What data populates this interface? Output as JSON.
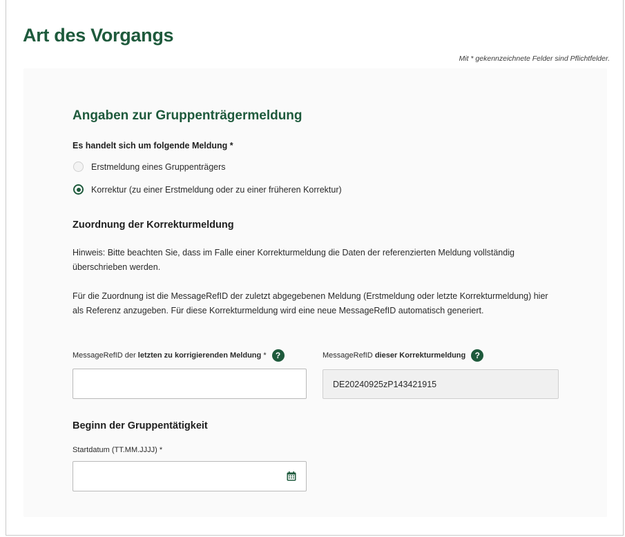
{
  "page": {
    "title": "Art des Vorgangs",
    "required_note": "Mit * gekennzeichnete Felder sind Pflichtfelder."
  },
  "section": {
    "title": "Angaben zur Gruppenträgermeldung",
    "question": "Es handelt sich um folgende Meldung *",
    "options": [
      {
        "label": "Erstmeldung eines Gruppenträgers",
        "selected": false
      },
      {
        "label": "Korrektur (zu einer Erstmeldung oder zu einer früheren Korrektur)",
        "selected": true
      }
    ]
  },
  "correction": {
    "heading": "Zuordnung der Korrekturmeldung",
    "hint": "Hinweis: Bitte beachten Sie, dass im Falle einer Korrekturmeldung die Daten der referenzierten Meldung vollständig überschrieben werden.",
    "info": "Für die Zuordnung ist die MessageRefID der zuletzt abgegebenen Meldung (Erstmeldung oder letzte Korrekturmeldung) hier als Referenz anzugeben. Für diese Korrekturmeldung wird eine neue MessageRefID automatisch generiert.",
    "field_ref": {
      "label_prefix": "MessageRefID der",
      "label_bold": "letzten zu korrigierenden Meldung",
      "label_suffix": "*",
      "value": ""
    },
    "field_new": {
      "label_prefix": "MessageRefID",
      "label_bold": "dieser Korrekturmeldung",
      "value": "DE20240925zP143421915"
    },
    "help_symbol": "?"
  },
  "start": {
    "heading": "Beginn der Gruppentätigkeit",
    "label": "Startdatum (TT.MM.JJJJ) *",
    "value": ""
  },
  "colors": {
    "accent": "#1e5a3c",
    "card_bg": "#fafafa",
    "readonly_bg": "#f0f0f0"
  }
}
